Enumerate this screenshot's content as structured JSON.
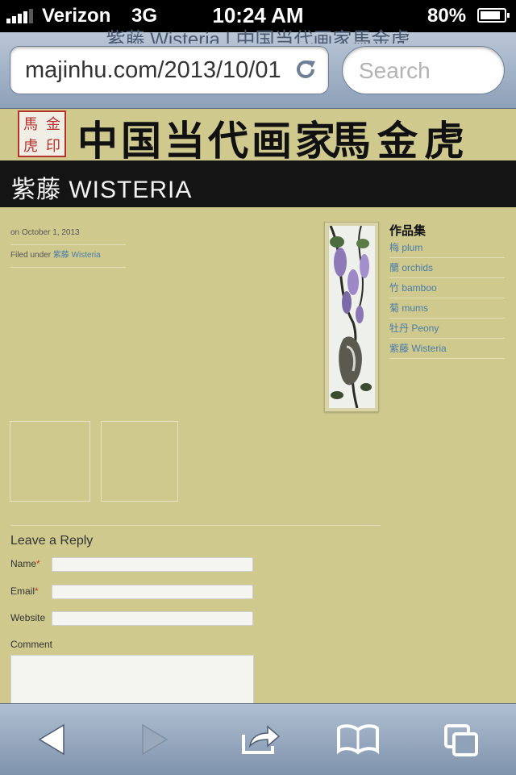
{
  "status_bar": {
    "carrier": "Verizon",
    "network": "3G",
    "time": "10:24 AM",
    "battery": "80%"
  },
  "browser": {
    "page_title": "紫藤 Wisteria | 中国当代画家馬金虎",
    "url": "majinhu.com/2013/10/01",
    "search_placeholder": "Search"
  },
  "site": {
    "seal_chars": [
      "馬",
      "金",
      "虎",
      "印"
    ],
    "calligraphy": "中国当代画家",
    "calligraphy_name": "馬金虎"
  },
  "post": {
    "title": "紫藤 WISTERIA",
    "date": "on October 1, 2013",
    "filed_prefix": "Filed under",
    "filed_category": "紫藤 Wisteria"
  },
  "sidebar": {
    "heading": "作品集",
    "items": [
      {
        "label": "梅 plum"
      },
      {
        "label": "蘭 orchids"
      },
      {
        "label": "竹 bamboo"
      },
      {
        "label": "菊 mums"
      },
      {
        "label": "牡丹 Peony"
      },
      {
        "label": "紫藤 Wisteria"
      }
    ]
  },
  "reply": {
    "title": "Leave a Reply",
    "name_label": "Name",
    "email_label": "Email",
    "website_label": "Website",
    "comment_label": "Comment",
    "required_mark": "*"
  },
  "toolbar": {
    "icons": [
      "back-arrow-icon",
      "forward-arrow-icon",
      "share-icon",
      "bookmarks-icon",
      "tabs-icon"
    ]
  }
}
